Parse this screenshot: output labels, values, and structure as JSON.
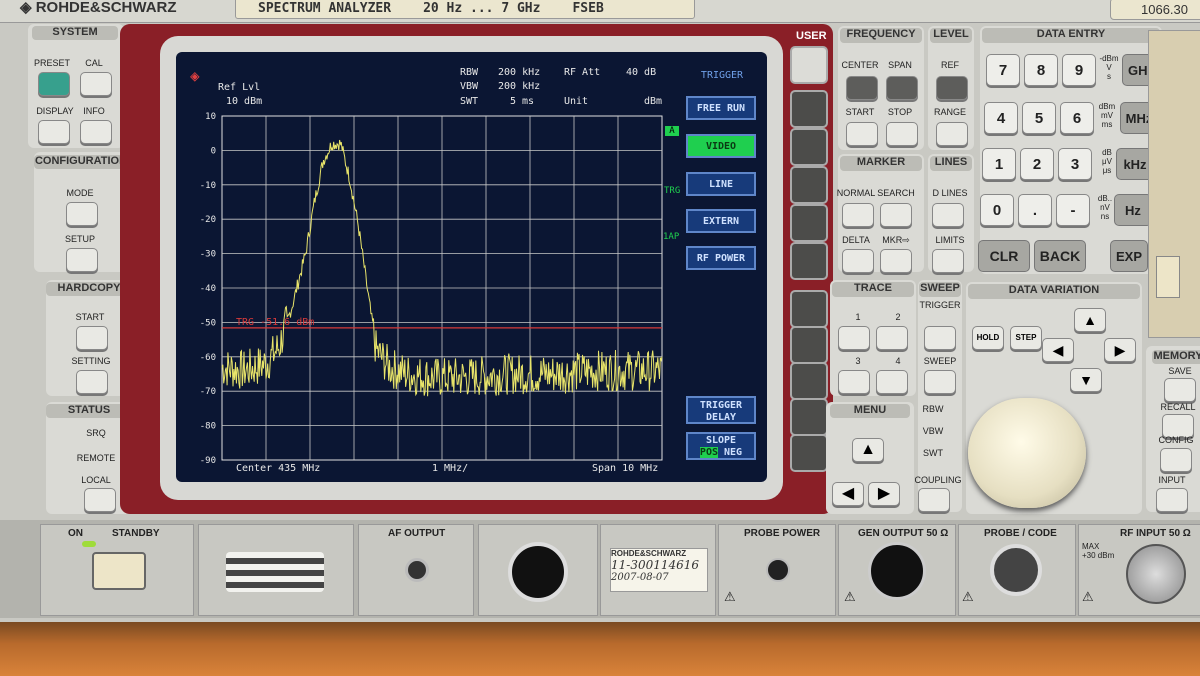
{
  "header": {
    "brand": "ROHDE&SCHWARZ",
    "instrument": "SPECTRUM ANALYZER",
    "range": "20 Hz ... 7 GHz",
    "model": "FSEB",
    "serial": "1066.30"
  },
  "screen": {
    "ref_lvl_label": "Ref Lvl",
    "ref_lvl_value": "10 dBm",
    "rbw_label": "RBW",
    "rbw_value": "200 kHz",
    "vbw_label": "VBW",
    "vbw_value": "200 kHz",
    "swt_label": "SWT",
    "swt_value": "5 ms",
    "rf_att_label": "RF Att",
    "rf_att_value": "40 dB",
    "unit_label": "Unit",
    "unit_value": "dBm",
    "trigger_line_label": "TRG -51.6 dBm",
    "center": "Center 435 MHz",
    "div": "1 MHz/",
    "span": "Span 10 MHz",
    "side_a": "A",
    "side_trg": "TRG",
    "side_1ap": "1AP",
    "softkey_title": "TRIGGER",
    "softkeys": [
      "FREE RUN",
      "VIDEO",
      "LINE",
      "EXTERN",
      "RF POWER"
    ],
    "softkeys_lower": [
      "TRIGGER DELAY",
      "SLOPE"
    ],
    "slope_pos": "POS",
    "slope_neg": "NEG",
    "user_label": "USER"
  },
  "chart_data": {
    "type": "line",
    "title": "",
    "ylabel": "",
    "xlabel": "",
    "ylim": [
      -90,
      10
    ],
    "xlim": [
      430,
      440
    ],
    "y_ticks": [
      "10",
      "0",
      "-10",
      "-20",
      "-30",
      "-40",
      "-50",
      "-60",
      "-70",
      "-80",
      "-90"
    ],
    "trigger_level": -51.6,
    "series": [
      {
        "x": [
          430.0,
          430.5,
          431.0,
          431.3,
          431.6,
          431.9,
          432.1,
          432.3,
          432.5,
          432.7,
          432.9,
          433.1,
          433.3,
          433.5,
          433.8,
          434.2,
          434.8,
          435.5,
          436.5,
          437.5,
          438.5,
          439.0,
          440.0
        ],
        "values": [
          -63,
          -64,
          -62,
          -57,
          -45,
          -30,
          -15,
          -3,
          2,
          2,
          -8,
          -22,
          -40,
          -58,
          -63,
          -65,
          -66,
          -66,
          -65,
          -65,
          -64,
          -64,
          -64
        ]
      }
    ],
    "grid": true
  },
  "panel": {
    "system": "SYSTEM",
    "preset": "PRESET",
    "cal": "CAL",
    "display": "DISPLAY",
    "info": "INFO",
    "configuration": "CONFIGURATION",
    "mode": "MODE",
    "setup": "SETUP",
    "hardcopy": "HARDCOPY",
    "start": "START",
    "setting": "SETTING",
    "status": "STATUS",
    "srq": "SRQ",
    "remote": "REMOTE",
    "local": "LOCAL",
    "frequency": "FREQUENCY",
    "center": "CENTER",
    "span": "SPAN",
    "start_f": "START",
    "stop": "STOP",
    "level": "LEVEL",
    "ref": "REF",
    "range_l": "RANGE",
    "marker": "MARKER",
    "normal": "NORMAL",
    "search": "SEARCH",
    "delta": "DELTA",
    "mkr": "MKR⇨",
    "lines": "LINES",
    "d_lines": "D LINES",
    "limits": "LIMITS",
    "trace": "TRACE",
    "sweep": "SWEEP",
    "trigger": "TRIGGER",
    "sweep2": "SWEEP",
    "rbw": "RBW",
    "vbw": "VBW",
    "swt": "SWT",
    "coupling": "COUPLING",
    "menu": "MENU",
    "data_entry": "DATA ENTRY",
    "data_variation": "DATA VARIATION",
    "hold": "HOLD",
    "step": "STEP",
    "memory": "MEMORY",
    "save": "SAVE",
    "recall": "RECALL",
    "config": "CONFIG",
    "input": "INPUT",
    "numbers": [
      "7",
      "8",
      "9",
      "4",
      "5",
      "6",
      "1",
      "2",
      "3",
      "0",
      ".",
      "-"
    ],
    "unit_keys": [
      "GHz",
      "MHz",
      "kHz",
      "Hz"
    ],
    "unit_hints": [
      "-dBm\nV\ns",
      "dBm\nmV\nms",
      "dB\nμV\nμs",
      "dB..\nnV\nns"
    ],
    "clr": "CLR",
    "back": "BACK",
    "exp": "EXP",
    "trace_nums": [
      "1",
      "2",
      "3",
      "4"
    ]
  },
  "footer": {
    "on": "ON",
    "standby": "STANDBY",
    "af_output": "AF OUTPUT",
    "probe_power": "PROBE POWER",
    "gen_output": "GEN OUTPUT 50 Ω",
    "probe_code": "PROBE / CODE",
    "rf_input": "RF INPUT 50 Ω",
    "max": "MAX\n+30 dBm",
    "sticker_brand": "ROHDE&SCHWARZ",
    "sticker_ref": "11-300114616",
    "sticker_date": "2007-08-07"
  }
}
